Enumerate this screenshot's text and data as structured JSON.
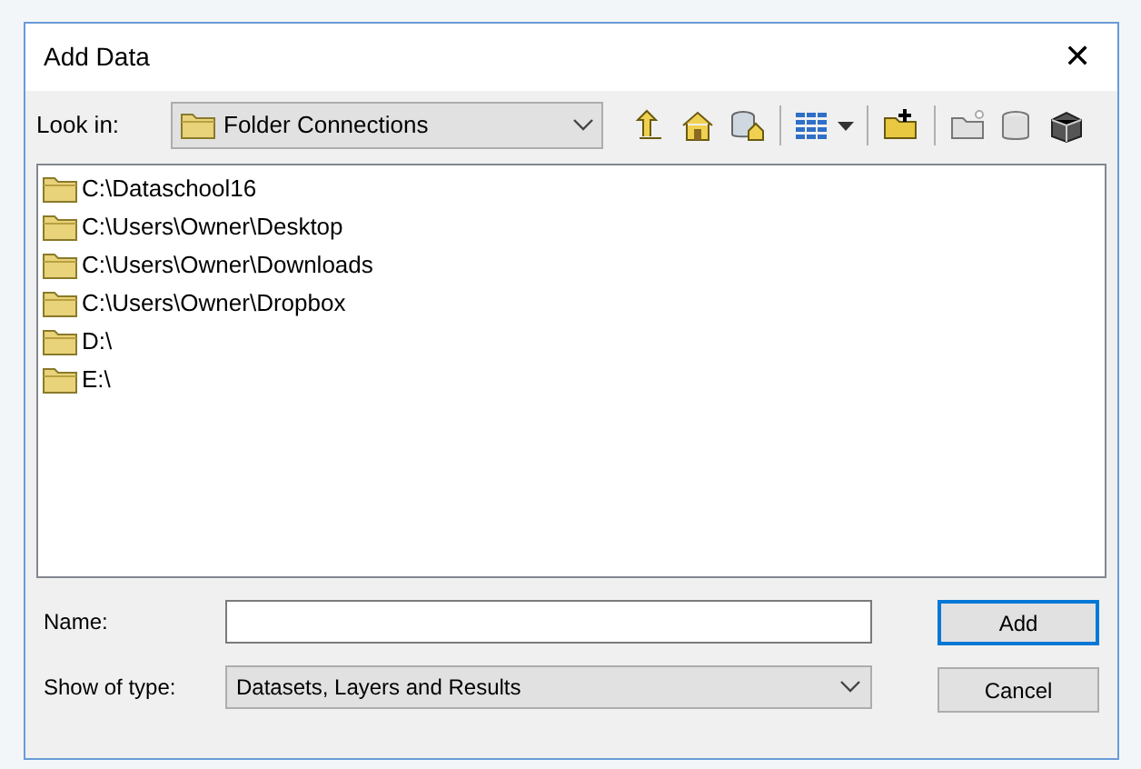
{
  "window": {
    "title": "Add Data",
    "close": "✕"
  },
  "look_in": {
    "label": "Look in:",
    "value": "Folder Connections"
  },
  "items": [
    {
      "label": "C:\\Dataschool16"
    },
    {
      "label": "C:\\Users\\Owner\\Desktop"
    },
    {
      "label": "C:\\Users\\Owner\\Downloads"
    },
    {
      "label": "C:\\Users\\Owner\\Dropbox"
    },
    {
      "label": "D:\\"
    },
    {
      "label": "E:\\"
    }
  ],
  "name_field": {
    "label": "Name:"
  },
  "type_field": {
    "label": "Show of type:",
    "value": "Datasets, Layers and Results"
  },
  "buttons": [
    {
      "label": "Add",
      "default": true
    },
    {
      "label": "Cancel",
      "default": false
    }
  ]
}
